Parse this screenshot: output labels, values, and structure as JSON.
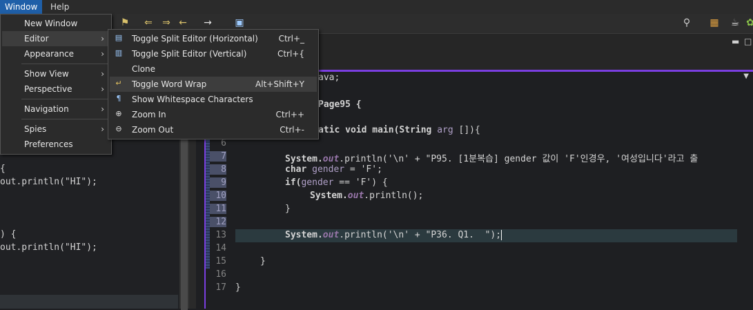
{
  "menubar": {
    "window": "Window",
    "help": "Help"
  },
  "window_menu": {
    "new_window": "New Window",
    "editor": "Editor",
    "appearance": "Appearance",
    "show_view": "Show View",
    "perspective": "Perspective",
    "navigation": "Navigation",
    "spies": "Spies",
    "preferences": "Preferences"
  },
  "editor_menu": {
    "items": [
      {
        "label": "Toggle Split Editor (Horizontal)",
        "shortcut": "Ctrl+_"
      },
      {
        "label": "Toggle Split Editor (Vertical)",
        "shortcut": "Ctrl+{"
      },
      {
        "label": "Clone",
        "shortcut": ""
      },
      {
        "label": "Toggle Word Wrap",
        "shortcut": "Alt+Shift+Y"
      },
      {
        "label": "Show Whitespace Characters",
        "shortcut": ""
      },
      {
        "label": "Zoom In",
        "shortcut": "Ctrl++"
      },
      {
        "label": "Zoom Out",
        "shortcut": "Ctrl+-"
      }
    ]
  },
  "left_code": {
    "l1": "{",
    "l2": "out.println(\"HI\");",
    "l3": ") {",
    "l4": "out.println(\"HI\");"
  },
  "code": {
    "line_numbers": [
      "6",
      "7",
      "8",
      "9",
      "10",
      "11",
      "12",
      "13",
      "14",
      "15",
      "16",
      "17"
    ],
    "frag_import": "ava;",
    "frag_class": "Page95 {",
    "frag_main_1": "atic void ",
    "frag_main_2": "main",
    "frag_main_3": "(String ",
    "frag_main_4": "arg",
    "frag_main_5": " []){",
    "line7_a": "System.",
    "line7_b": "out",
    "line7_c": ".println('\\n' + \"P95. [1분복습] gender 값이 'F'인경우, '여성입니다'라고 출",
    "line8_a": "char ",
    "line8_b": "gender",
    "line8_c": " = 'F';",
    "line9_a": "if(",
    "line9_b": "gender",
    "line9_c": " == 'F') {",
    "line10_a": "System.",
    "line10_b": "out",
    "line10_c": ".println();",
    "line11": "}",
    "line13_a": "System.",
    "line13_b": "out",
    "line13_c": ".println('\\n' + \"P36. Q1.  \");",
    "line15": "}",
    "line17": "}"
  }
}
